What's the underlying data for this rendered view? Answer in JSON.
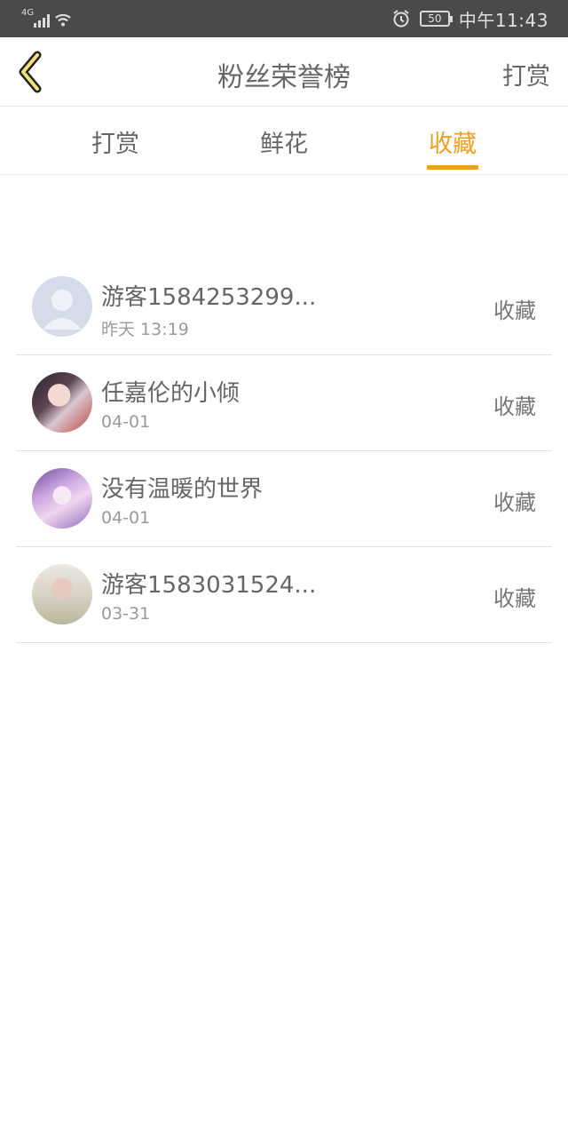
{
  "status_bar": {
    "network": "4G",
    "battery": "50",
    "time": "中午11:43"
  },
  "header": {
    "title": "粉丝荣誉榜",
    "action": "打赏"
  },
  "tabs": [
    {
      "label": "打赏",
      "active": false
    },
    {
      "label": "鲜花",
      "active": false
    },
    {
      "label": "收藏",
      "active": true
    }
  ],
  "accent_color": "#f0a020",
  "list": [
    {
      "name": "游客1584253299...",
      "time": "昨天 13:19",
      "type": "收藏",
      "avatar": "default-user-avatar"
    },
    {
      "name": "任嘉伦的小倾",
      "time": "04-01",
      "type": "收藏",
      "avatar": "user-photo-avatar"
    },
    {
      "name": "没有温暖的世界",
      "time": "04-01",
      "type": "收藏",
      "avatar": "anime-avatar"
    },
    {
      "name": "游客1583031524...",
      "time": "03-31",
      "type": "收藏",
      "avatar": "user-photo-avatar"
    }
  ]
}
